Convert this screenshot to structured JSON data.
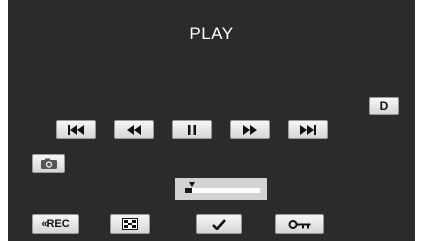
{
  "screen": {
    "title": "PLAY"
  },
  "buttons": {
    "d_label": "D",
    "rec_label": "REC",
    "rec_chevron": "«"
  },
  "slider": {
    "position_fraction": 0.09
  },
  "icons": {
    "skip_back": "skip-back-icon",
    "rewind": "rewind-icon",
    "pause": "pause-icon",
    "forward": "fast-forward-icon",
    "skip_forward": "skip-forward-icon",
    "snapshot": "camera-icon",
    "index": "index-grid-icon",
    "ok": "checkmark-icon",
    "protect": "key-icon"
  },
  "colors": {
    "background": "#2b2b2b",
    "button_face": "#e8e8e8",
    "text": "#ffffff"
  }
}
